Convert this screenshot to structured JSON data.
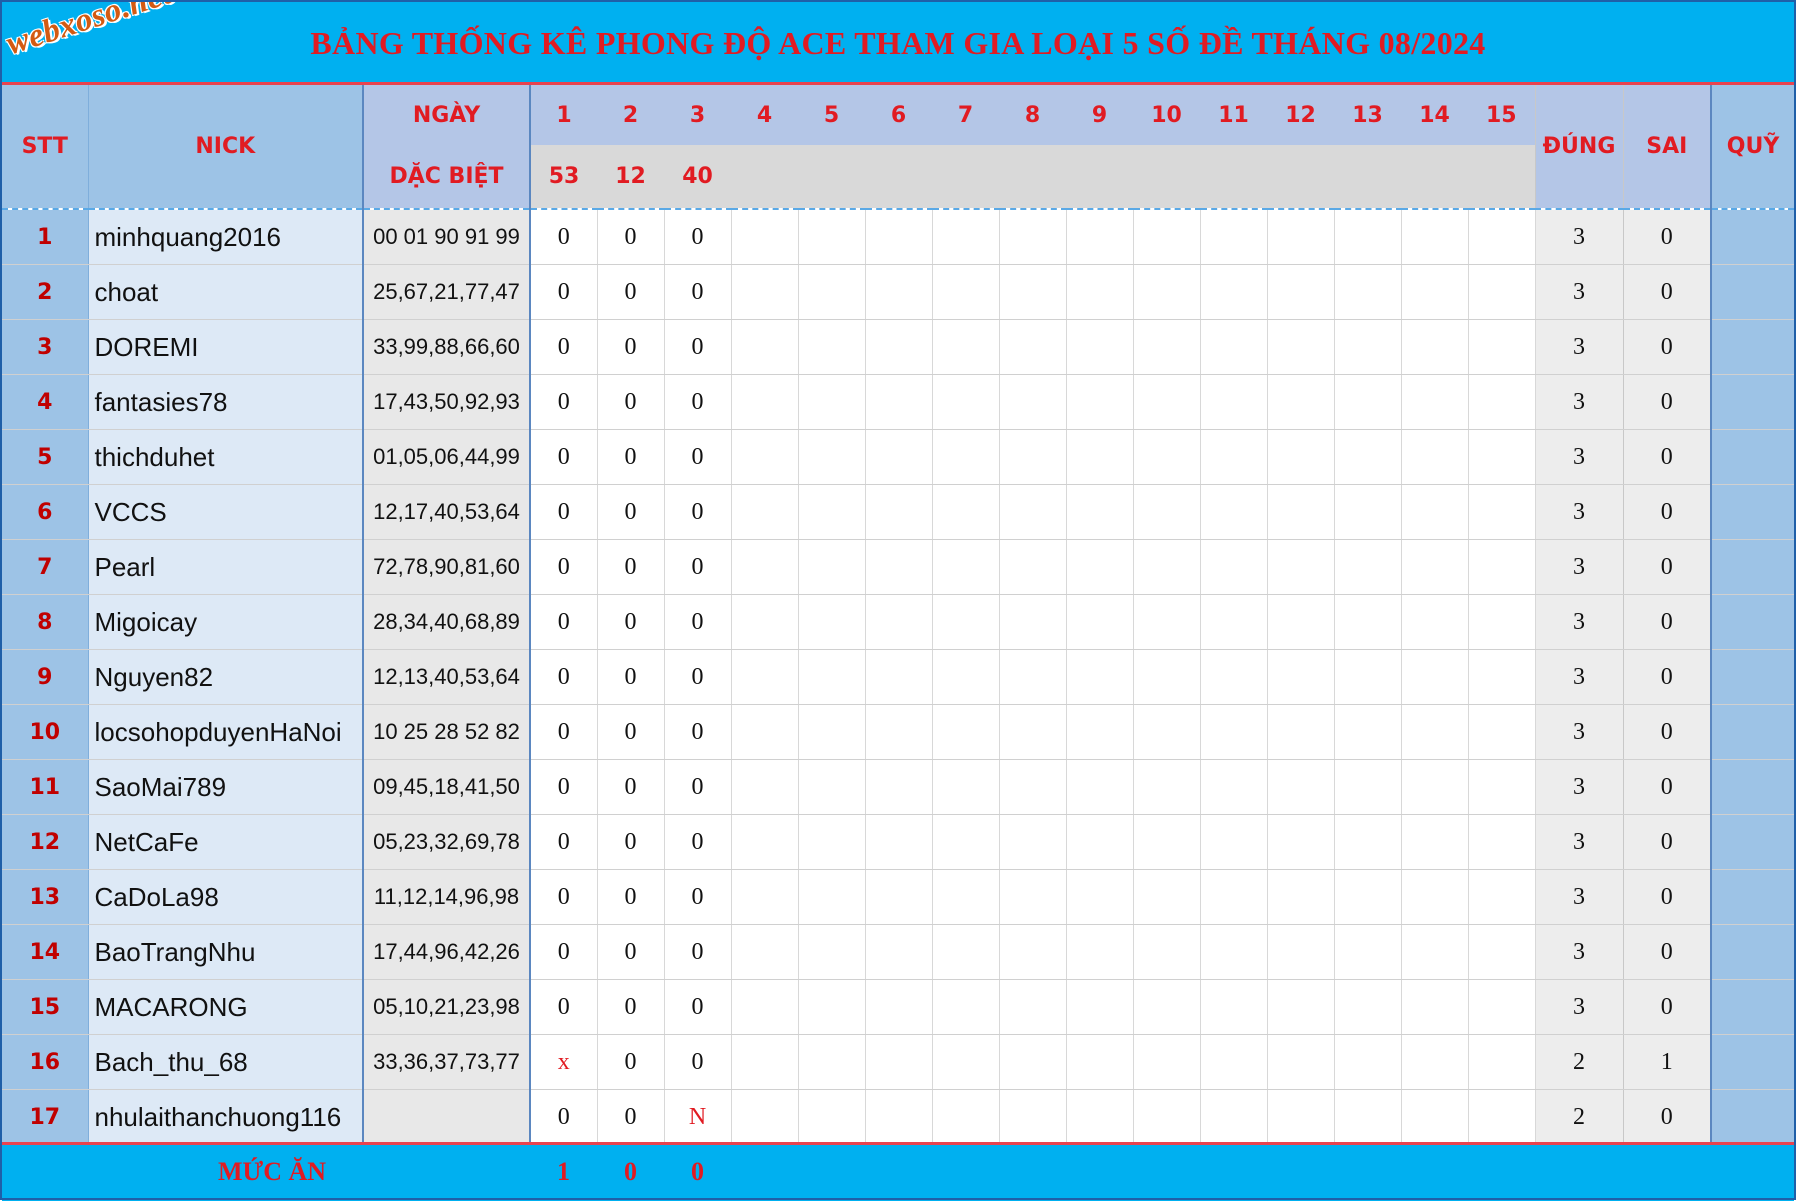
{
  "title": "BẢNG THỐNG KÊ PHONG ĐỘ ACE THAM GIA LOẠI 5 SỐ ĐỀ THÁNG 08/2024",
  "logo": "webxoso.net",
  "header": {
    "stt": "STT",
    "nick": "NICK",
    "ngay": "NGÀY",
    "dac_biet": "DẶC BIỆT",
    "dung": "ĐÚNG",
    "sai": "SAI",
    "quy": "QUỸ",
    "days": [
      "1",
      "2",
      "3",
      "4",
      "5",
      "6",
      "7",
      "8",
      "9",
      "10",
      "11",
      "12",
      "13",
      "14",
      "15"
    ],
    "specials": [
      "53",
      "12",
      "40",
      "",
      "",
      "",
      "",
      "",
      "",
      "",
      "",
      "",
      "",
      "",
      ""
    ]
  },
  "rows": [
    {
      "stt": "1",
      "nick": "minhquang2016",
      "numbers": "00 01 90 91 99",
      "results": [
        "0",
        "0",
        "0"
      ],
      "dung": "3",
      "sai": "0"
    },
    {
      "stt": "2",
      "nick": "choat",
      "numbers": "25,67,21,77,47",
      "results": [
        "0",
        "0",
        "0"
      ],
      "dung": "3",
      "sai": "0"
    },
    {
      "stt": "3",
      "nick": "DOREMI",
      "numbers": "33,99,88,66,60",
      "results": [
        "0",
        "0",
        "0"
      ],
      "dung": "3",
      "sai": "0"
    },
    {
      "stt": "4",
      "nick": "fantasies78",
      "numbers": "17,43,50,92,93",
      "results": [
        "0",
        "0",
        "0"
      ],
      "dung": "3",
      "sai": "0"
    },
    {
      "stt": "5",
      "nick": "thichduhet",
      "numbers": "01,05,06,44,99",
      "results": [
        "0",
        "0",
        "0"
      ],
      "dung": "3",
      "sai": "0"
    },
    {
      "stt": "6",
      "nick": "VCCS",
      "numbers": "12,17,40,53,64",
      "results": [
        "0",
        "0",
        "0"
      ],
      "dung": "3",
      "sai": "0"
    },
    {
      "stt": "7",
      "nick": "Pearl",
      "numbers": "72,78,90,81,60",
      "results": [
        "0",
        "0",
        "0"
      ],
      "dung": "3",
      "sai": "0"
    },
    {
      "stt": "8",
      "nick": "Migoicay",
      "numbers": "28,34,40,68,89",
      "results": [
        "0",
        "0",
        "0"
      ],
      "dung": "3",
      "sai": "0"
    },
    {
      "stt": "9",
      "nick": "Nguyen82",
      "numbers": "12,13,40,53,64",
      "results": [
        "0",
        "0",
        "0"
      ],
      "dung": "3",
      "sai": "0"
    },
    {
      "stt": "10",
      "nick": "locsohopduyenHaNoi",
      "numbers": "10 25 28 52 82",
      "results": [
        "0",
        "0",
        "0"
      ],
      "dung": "3",
      "sai": "0"
    },
    {
      "stt": "11",
      "nick": "SaoMai789",
      "numbers": "09,45,18,41,50",
      "results": [
        "0",
        "0",
        "0"
      ],
      "dung": "3",
      "sai": "0"
    },
    {
      "stt": "12",
      "nick": "NetCaFe",
      "numbers": "05,23,32,69,78",
      "results": [
        "0",
        "0",
        "0"
      ],
      "dung": "3",
      "sai": "0"
    },
    {
      "stt": "13",
      "nick": "CaDoLa98",
      "numbers": "11,12,14,96,98",
      "results": [
        "0",
        "0",
        "0"
      ],
      "dung": "3",
      "sai": "0"
    },
    {
      "stt": "14",
      "nick": "BaoTrangNhu",
      "numbers": "17,44,96,42,26",
      "results": [
        "0",
        "0",
        "0"
      ],
      "dung": "3",
      "sai": "0"
    },
    {
      "stt": "15",
      "nick": "MACARONG",
      "numbers": "05,10,21,23,98",
      "results": [
        "0",
        "0",
        "0"
      ],
      "dung": "3",
      "sai": "0"
    },
    {
      "stt": "16",
      "nick": "Bach_thu_68",
      "numbers": "33,36,37,73,77",
      "results": [
        "x",
        "0",
        "0"
      ],
      "dung": "2",
      "sai": "1"
    },
    {
      "stt": "17",
      "nick": "nhulaithanchuong116",
      "numbers": "",
      "results": [
        "0",
        "0",
        "N"
      ],
      "dung": "2",
      "sai": "0"
    }
  ],
  "footer": {
    "label": "MỨC ĂN",
    "values": [
      "1",
      "0",
      "0"
    ]
  },
  "colors": {
    "title_bar": "#00b0f0",
    "title_text": "#e11b22",
    "header_bg": "#b4c6e7",
    "stt_col": "#9dc3e6",
    "nick_col": "#dde9f6",
    "special_row": "#d9d9d9",
    "mark_red": "#e11b22"
  }
}
